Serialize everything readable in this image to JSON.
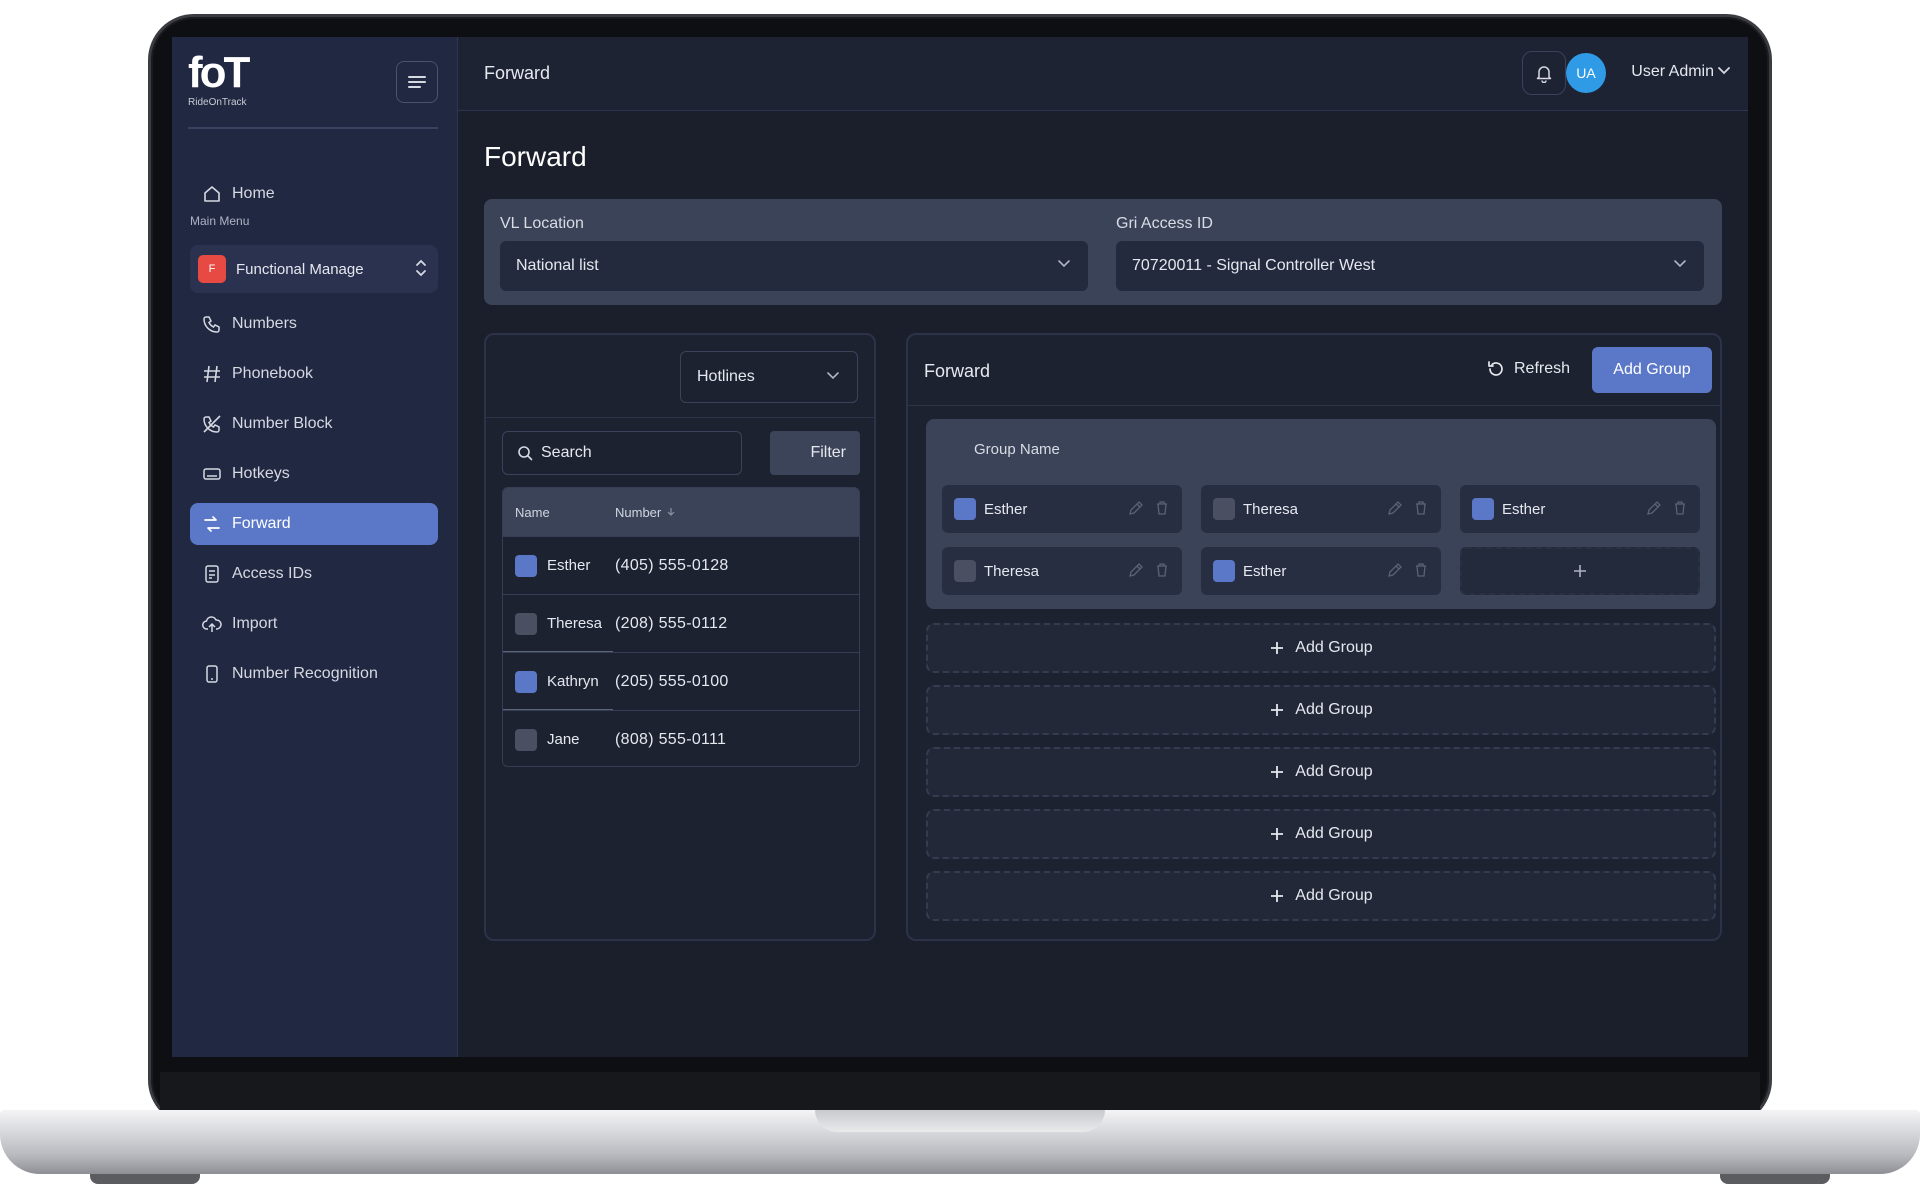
{
  "brand": {
    "logo_text": "foT",
    "logo_sub": "RideOnTrack"
  },
  "sidebar": {
    "section_label": "Main Menu",
    "functional": {
      "badge": "F",
      "label": "Functional Manage"
    },
    "items": [
      {
        "label": "Home",
        "icon": "home-icon"
      },
      {
        "label": "Numbers",
        "icon": "phone-icon"
      },
      {
        "label": "Phonebook",
        "icon": "hash-icon"
      },
      {
        "label": "Number Block",
        "icon": "phone-block-icon"
      },
      {
        "label": "Hotkeys",
        "icon": "keyboard-icon"
      },
      {
        "label": "Forward",
        "icon": "forward-icon",
        "active": true
      },
      {
        "label": "Access IDs",
        "icon": "id-card-icon"
      },
      {
        "label": "Import",
        "icon": "cloud-upload-icon"
      },
      {
        "label": "Number Recognition",
        "icon": "mobile-icon"
      }
    ]
  },
  "topbar": {
    "title": "Forward",
    "user_initials": "UA",
    "user_name": "User Admin"
  },
  "page": {
    "title": "Forward"
  },
  "filters": {
    "vl_location_label": "VL Location",
    "vl_location_value": "National list",
    "access_id_label": "Gri Access ID",
    "access_id_value": "70720011 - Signal Controller West"
  },
  "left_panel": {
    "dropdown_value": "Hotlines",
    "search_placeholder": "Search",
    "filter_label": "Filter",
    "columns": {
      "name": "Name",
      "number": "Number"
    },
    "rows": [
      {
        "name": "Esther",
        "number": "(405) 555-0128",
        "checked": true
      },
      {
        "name": "Theresa",
        "number": "(208) 555-0112",
        "checked": false
      },
      {
        "name": "Kathryn",
        "number": "(205) 555-0100",
        "checked": true
      },
      {
        "name": "Jane",
        "number": "(808) 555-0111",
        "checked": false
      }
    ]
  },
  "right_panel": {
    "title": "Forward",
    "refresh_label": "Refresh",
    "add_group_label": "Add Group",
    "group_name_label": "Group Name",
    "chips": [
      {
        "name": "Esther",
        "checked": true
      },
      {
        "name": "Theresa",
        "checked": false
      },
      {
        "name": "Esther",
        "checked": true
      },
      {
        "name": "Theresa",
        "checked": false
      },
      {
        "name": "Esther",
        "checked": true
      }
    ],
    "add_rows": [
      "Add Group",
      "Add Group",
      "Add Group",
      "Add Group",
      "Add Group"
    ]
  },
  "colors": {
    "accent": "#5b78c8",
    "sidebar": "#212841",
    "background": "#1b1f2c",
    "badge": "#e64a43",
    "avatar": "#2f9ae6"
  }
}
